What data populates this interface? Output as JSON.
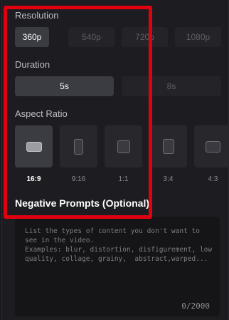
{
  "resolution": {
    "label": "Resolution",
    "options": [
      "360p",
      "540p",
      "720p",
      "1080p"
    ],
    "selected": "360p"
  },
  "duration": {
    "label": "Duration",
    "options": [
      "5s",
      "8s"
    ],
    "selected": "5s"
  },
  "aspect_ratio": {
    "label": "Aspect Ratio",
    "options": [
      "16:9",
      "9:16",
      "1:1",
      "3:4",
      "4:3"
    ],
    "selected": "16:9"
  },
  "negative_prompts": {
    "title": "Negative Prompts (Optional)",
    "placeholder": "List the types of content you don't want to see in the video.\nExamples: blur, distortion, disfigurement, low quality, collage, grainy,  abstract,warped...",
    "counter": "0/2000"
  },
  "colors": {
    "highlight": "#e0000f",
    "panel_bg": "#1d1d21",
    "active_bg": "#3b3b42"
  }
}
